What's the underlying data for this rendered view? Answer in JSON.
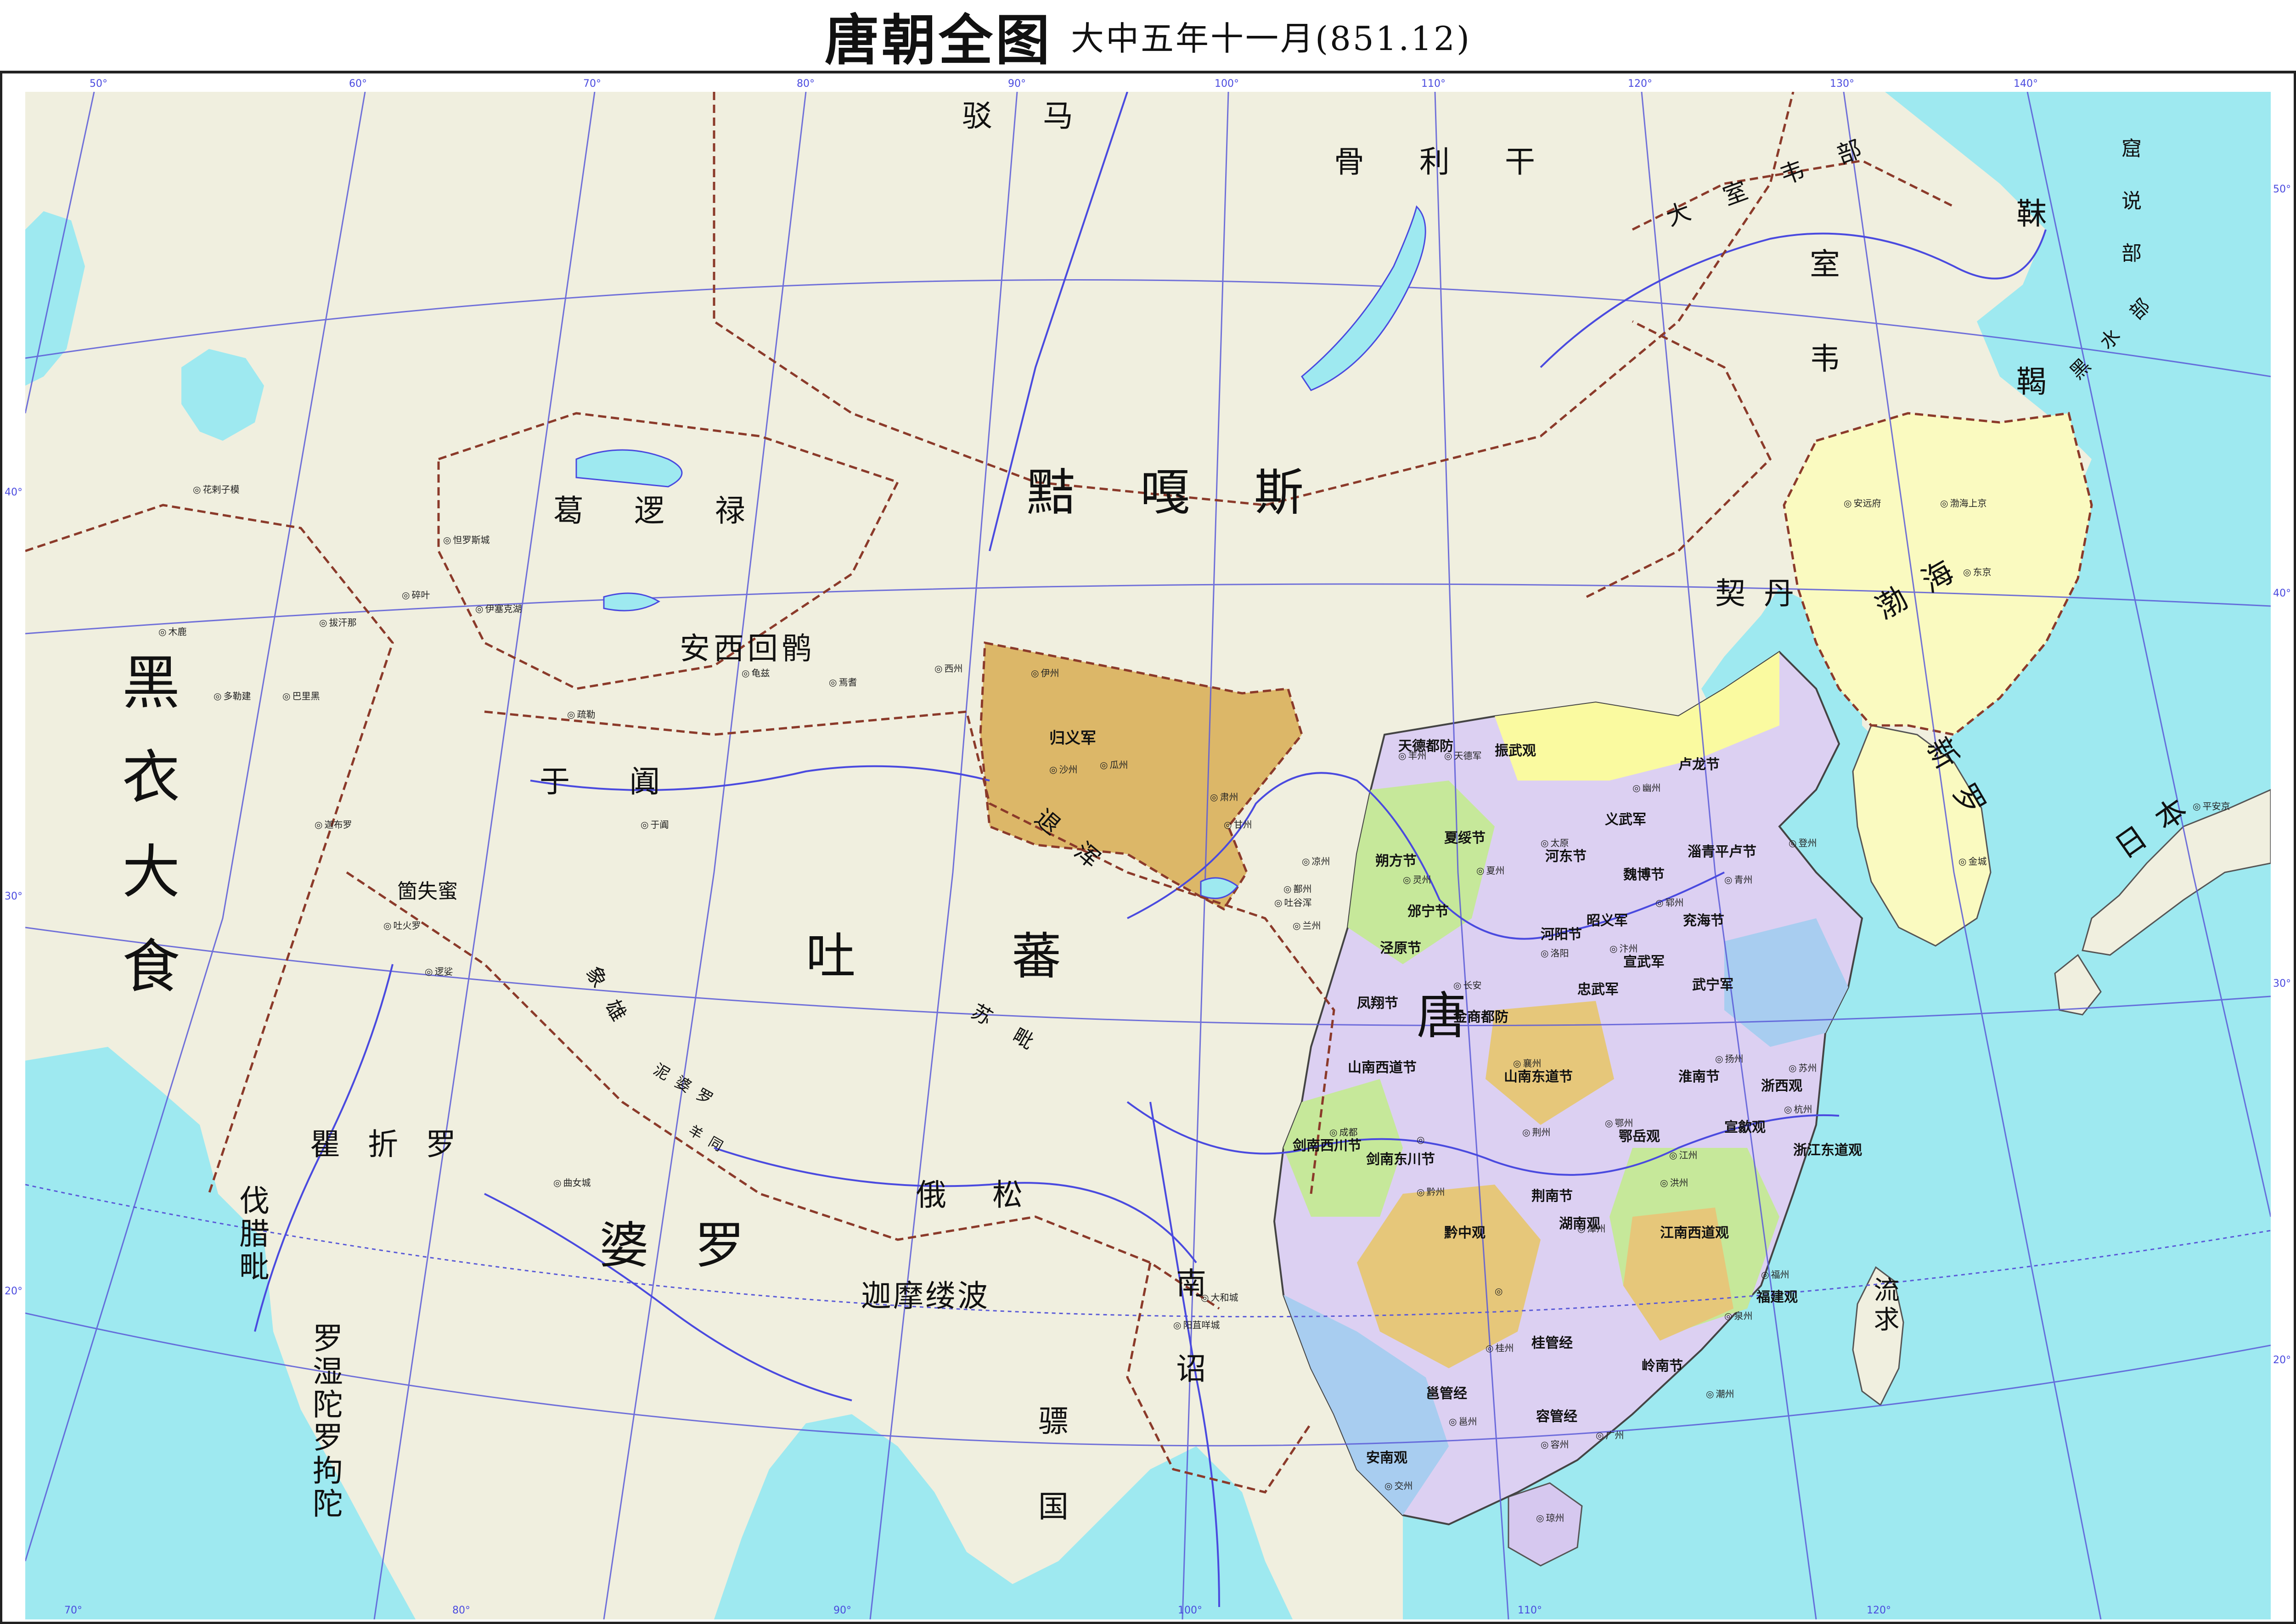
{
  "title": {
    "main": "唐朝全图",
    "sub": "大中五年十一月(851.12)"
  },
  "colors": {
    "land": "#f0efdf",
    "sea": "#9ee9f0",
    "tang_yellow": "#fafaa0",
    "tang_purple": "#dcd0f2",
    "tang_green": "#c6e89a",
    "tang_blue": "#a8cdf0",
    "tang_tan": "#e6c77a",
    "guiyi": "#dcb768",
    "bohai": "#fafac0",
    "river": "#4a4adf",
    "grid": "#5a5ad8",
    "border": "#8b3a2a"
  },
  "regions": [
    {
      "name": "黠嘎斯"
    },
    {
      "name": "骨利干"
    },
    {
      "name": "驳马"
    },
    {
      "name": "葛逻禄"
    },
    {
      "name": "安西回鹘"
    },
    {
      "name": "于阗"
    },
    {
      "name": "吐蕃"
    },
    {
      "name": "婆罗"
    },
    {
      "name": "瞿折罗"
    },
    {
      "name": "俄松"
    },
    {
      "name": "迦摩缕波"
    },
    {
      "name": "南诏"
    },
    {
      "name": "骠国"
    },
    {
      "name": "唐"
    },
    {
      "name": "渤海"
    },
    {
      "name": "新罗"
    },
    {
      "name": "日本"
    },
    {
      "name": "流求"
    },
    {
      "name": "黑衣大食"
    },
    {
      "name": "伐腊毗"
    },
    {
      "name": "罗湿陀罗拘陀"
    },
    {
      "name": "契丹"
    },
    {
      "name": "室韦"
    },
    {
      "name": "大室韦部"
    },
    {
      "name": "靺鞨"
    },
    {
      "name": "窟说部"
    },
    {
      "name": "黑水部"
    },
    {
      "name": "归义军"
    },
    {
      "name": "箇失蜜"
    },
    {
      "name": "象雄"
    },
    {
      "name": "泥婆罗"
    },
    {
      "name": "苏毗"
    },
    {
      "name": "退浑"
    },
    {
      "name": "羊同"
    }
  ],
  "tang_provinces": [
    "天德都防",
    "振武观",
    "卢龙节",
    "夏绥节",
    "朔方节",
    "河东节",
    "义武军",
    "魏博节",
    "淄青平卢节",
    "兖海节",
    "泾原节",
    "邠宁节",
    "凤翔节",
    "昭义军",
    "河阳节",
    "宣武军",
    "忠武军",
    "武宁军",
    "山南西道节",
    "山南东道节",
    "金商都防",
    "荆南节",
    "鄂岳观",
    "淮南节",
    "浙西观",
    "浙江东道观",
    "宣歙观",
    "江南西道观",
    "福建观",
    "黔中观",
    "湖南观",
    "剑南西川节",
    "剑南东川节",
    "岭南节",
    "桂管经",
    "邕管经",
    "容管经",
    "安南观"
  ],
  "cities": [
    "花剌子模",
    "木鹿",
    "多勒建",
    "巴里黑",
    "怛罗斯城",
    "碎叶",
    "伊塞克湖",
    "龟兹",
    "伊州",
    "西州",
    "焉耆",
    "沙州",
    "瓜州",
    "肃州",
    "甘州",
    "凉州",
    "于阗",
    "疏勒",
    "迦布罗",
    "吐火罗",
    "拔汗那",
    "逻娑",
    "曲女城",
    "吐谷浑",
    "兰州",
    "长安",
    "洛阳",
    "太原",
    "幽州",
    "扬州",
    "苏州",
    "杭州",
    "福州",
    "广州",
    "交州",
    "成都",
    "黔州",
    "潭州",
    "洪州",
    "江州",
    "鄂州",
    "荆州",
    "襄州",
    "汴州",
    "郓州",
    "青州",
    "登州",
    "渤海上京",
    "安远府",
    "东京",
    "平安京",
    "金城",
    "大和城",
    "阳苴咩城",
    "丰州",
    "天德军",
    "灵州",
    "夏州",
    "鄯州",
    "泉州",
    "潮州",
    "邕州",
    "桂州",
    "容州",
    "琼州"
  ],
  "graticule": {
    "lon_top": [
      "50°",
      "60°",
      "70°",
      "80°",
      "90°",
      "100°",
      "110°",
      "120°",
      "130°",
      "140°"
    ],
    "lon_bottom": [
      "70°",
      "80°",
      "90°",
      "100°",
      "110°",
      "120°"
    ],
    "lat_left": [
      "40°",
      "30°",
      "20°"
    ],
    "lat_right": [
      "50°",
      "40°",
      "30°",
      "20°"
    ]
  }
}
